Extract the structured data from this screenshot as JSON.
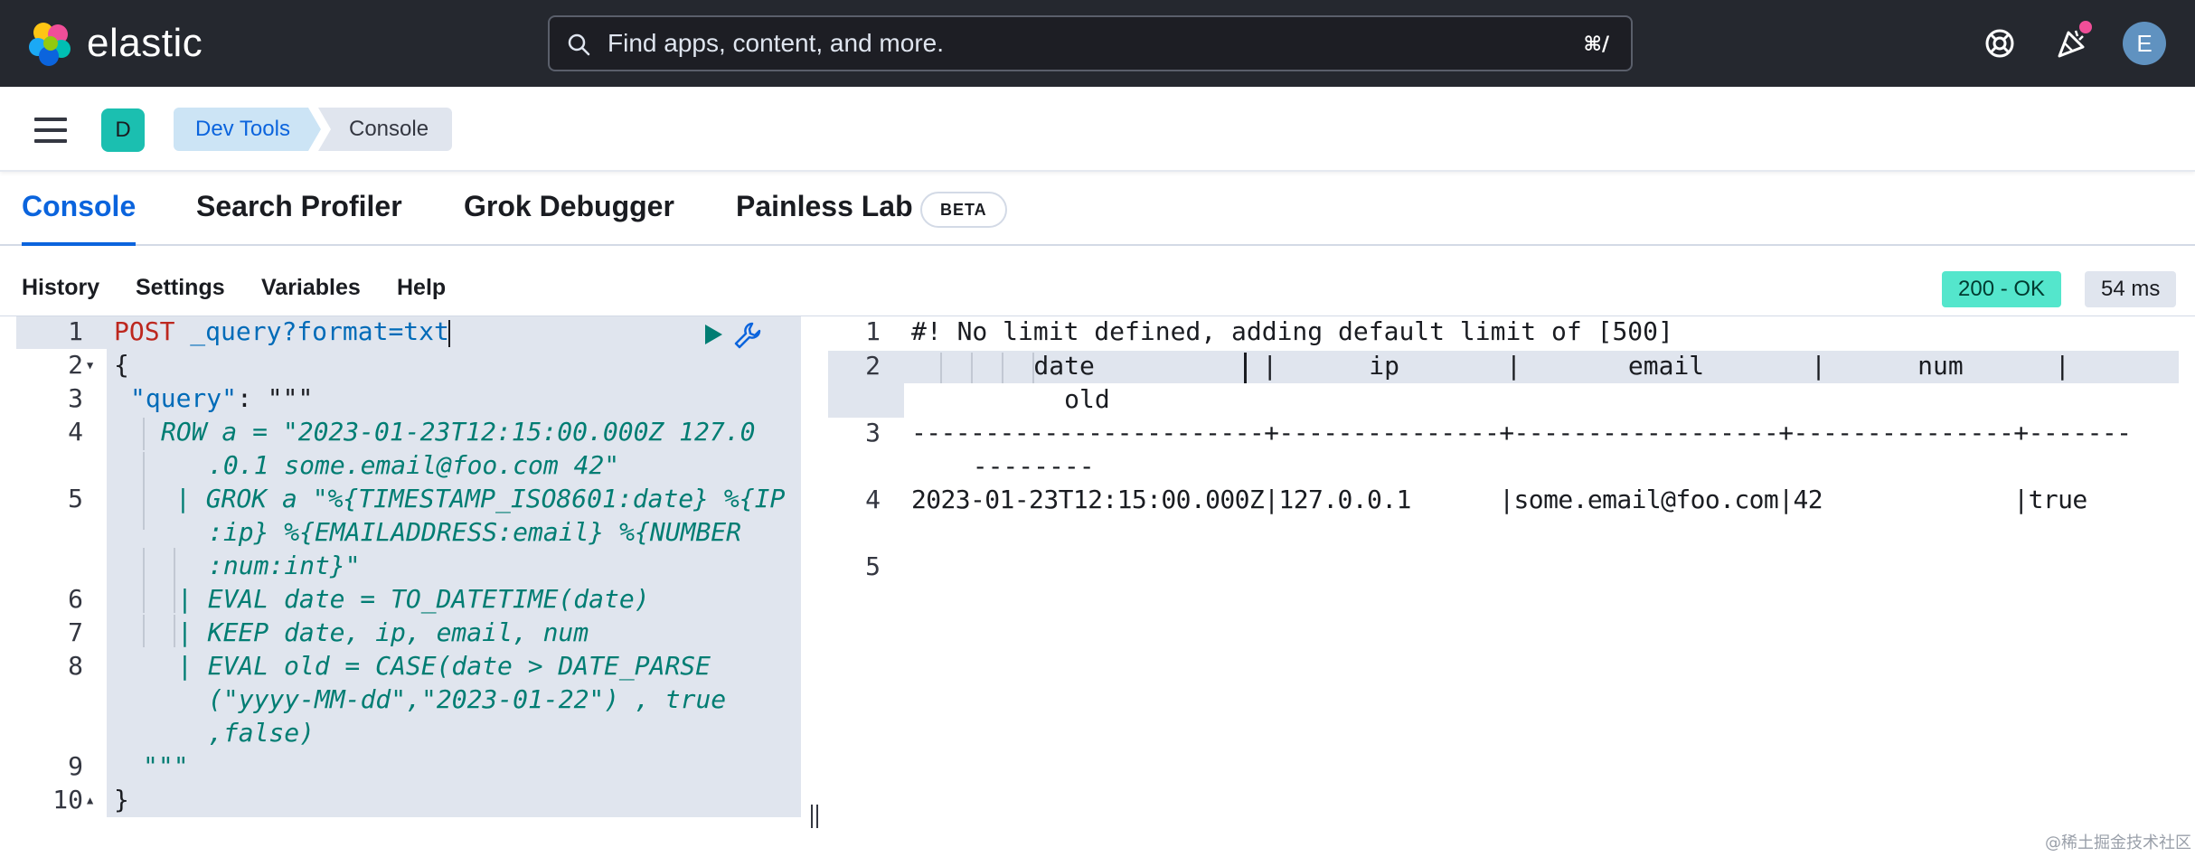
{
  "header": {
    "brand": "elastic",
    "search_placeholder": "Find apps, content, and more.",
    "search_shortcut": "⌘/",
    "avatar_initial": "E"
  },
  "breadcrumbs": {
    "space_initial": "D",
    "items": [
      "Dev Tools",
      "Console"
    ]
  },
  "tabs": [
    {
      "label": "Console",
      "active": true
    },
    {
      "label": "Search Profiler"
    },
    {
      "label": "Grok Debugger"
    },
    {
      "label": "Painless Lab"
    }
  ],
  "beta_badge": "BETA",
  "toolbar": {
    "history": "History",
    "settings": "Settings",
    "variables": "Variables",
    "help": "Help",
    "status": "200 - OK",
    "time": "54 ms"
  },
  "editor": {
    "line_numbers": [
      "1",
      "2",
      "3",
      "4",
      "5",
      "6",
      "7",
      "8",
      "9",
      "10"
    ],
    "lines": {
      "l1_method": "POST",
      "l1_url": "_query?format=txt",
      "l2": "{",
      "l3_key": "\"query\"",
      "l3_rest": ": \"\"\"",
      "l4a": "ROW a = \"2023-01-23T12:15:00.000Z 127.0",
      "l4b": ".0.1 some.email@foo.com 42\"",
      "l5a": "| GROK a \"%{TIMESTAMP_ISO8601:date} %{IP",
      "l5b": ":ip} %{EMAILADDRESS:email} %{NUMBER",
      "l5c": ":num:int}\"",
      "l6": "| EVAL date = TO_DATETIME(date)",
      "l7": "| KEEP date, ip, email, num",
      "l8a": "| EVAL old = CASE(date > DATE_PARSE",
      "l8b": "(\"yyyy-MM-dd\",\"2023-01-22\") , true",
      "l8c": ",false)",
      "l9": "\"\"\"",
      "l10": "}"
    }
  },
  "output": {
    "line_numbers": [
      "1",
      "2",
      "3",
      "4",
      "5"
    ],
    "lines": {
      "o1": "#! No limit defined, adding default limit of [500]",
      "o2a": "    date           |      ip       |       email       |      num      |",
      "o2b": "      old",
      "o3a": "------------------------+---------------+------------------+---------------+-------",
      "o3b": "  --------",
      "o4": "2023-01-23T12:15:00.000Z|127.0.0.1      |some.email@foo.com|42             |true"
    }
  },
  "watermark": "@稀土掘金技术社区",
  "colors": {
    "header_bg": "#25282f",
    "accent": "#0b64dd",
    "status_ok": "#54e6cc",
    "method": "#bd271e",
    "string": "#017d73"
  }
}
